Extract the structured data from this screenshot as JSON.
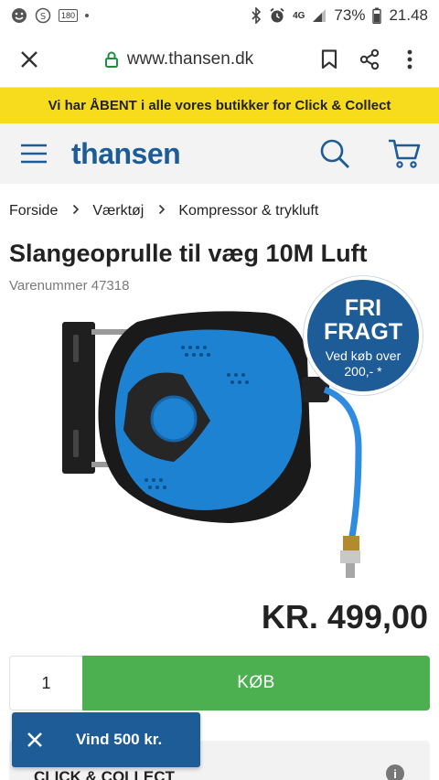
{
  "status_bar": {
    "badge": "180",
    "network": "4G",
    "battery": "73%",
    "time": "21.48"
  },
  "browser": {
    "url": "www.thansen.dk"
  },
  "promo": {
    "text": "Vi har ÅBENT i alle vores butikker for Click & Collect"
  },
  "header": {
    "logo": "thansen"
  },
  "breadcrumb": {
    "items": [
      "Forside",
      "Værktøj",
      "Kompressor & trykluft"
    ]
  },
  "product": {
    "title": "Slangeoprulle til væg 10M Luft",
    "sku_label": "Varenummer 47318",
    "price": "KR. 499,00",
    "quantity": "1",
    "buy_label": "KØB"
  },
  "badge": {
    "line1": "FRI",
    "line2": "FRAGT",
    "line3": "Ved køb over",
    "line4": "200,- *"
  },
  "click_collect": {
    "label": "CLICK & COLLECT"
  },
  "toast": {
    "label": "Vind 500 kr."
  },
  "colors": {
    "brand_blue": "#1d5c97",
    "promo_yellow": "#f7dc1e",
    "buy_green": "#4caf50",
    "lock_green": "#1e8e3e"
  }
}
